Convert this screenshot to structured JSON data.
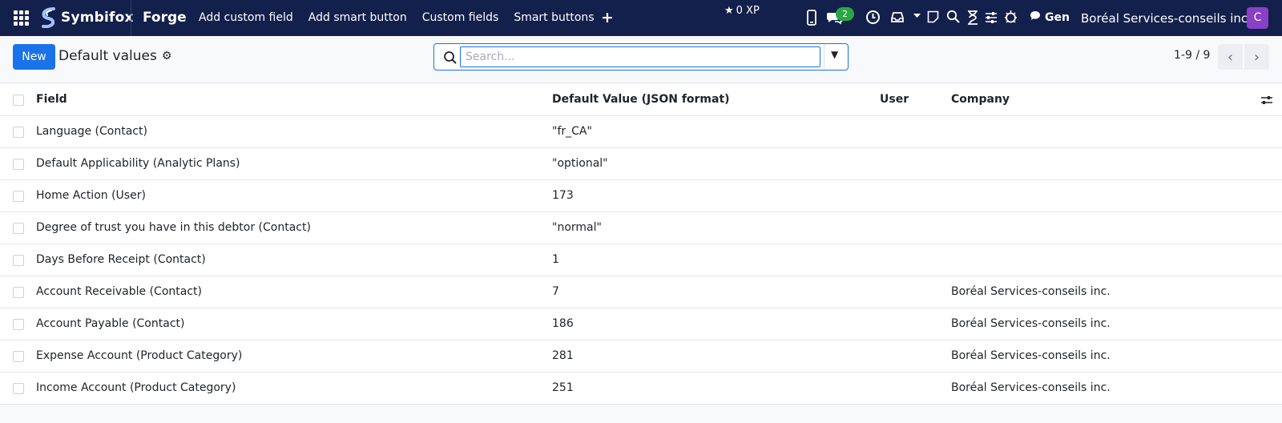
{
  "navbar": {
    "brand": "Symbifox",
    "app_name": "Forge",
    "menu": [
      "Add custom field",
      "Add smart button",
      "Custom fields",
      "Smart buttons"
    ],
    "xp": "0 XP",
    "messages_count": "2",
    "user_short": "Gen",
    "company": "Boréal Services-conseils inc.",
    "avatar_letter": "C"
  },
  "control": {
    "new_label": "New",
    "title": "Default values",
    "search_placeholder": "Search...",
    "pager": "1-9 / 9"
  },
  "table": {
    "headers": [
      "Field",
      "Default Value (JSON format)",
      "User",
      "Company"
    ],
    "rows": [
      {
        "field": "Language (Contact)",
        "value": "\"fr_CA\"",
        "user": "",
        "company": ""
      },
      {
        "field": "Default Applicability (Analytic Plans)",
        "value": "\"optional\"",
        "user": "",
        "company": ""
      },
      {
        "field": "Home Action (User)",
        "value": "173",
        "user": "",
        "company": ""
      },
      {
        "field": "Degree of trust you have in this debtor (Contact)",
        "value": "\"normal\"",
        "user": "",
        "company": ""
      },
      {
        "field": "Days Before Receipt (Contact)",
        "value": "1",
        "user": "",
        "company": ""
      },
      {
        "field": "Account Receivable (Contact)",
        "value": "7",
        "user": "",
        "company": "Boréal Services-conseils inc."
      },
      {
        "field": "Account Payable (Contact)",
        "value": "186",
        "user": "",
        "company": "Boréal Services-conseils inc."
      },
      {
        "field": "Expense Account (Product Category)",
        "value": "281",
        "user": "",
        "company": "Boréal Services-conseils inc."
      },
      {
        "field": "Income Account (Product Category)",
        "value": "251",
        "user": "",
        "company": "Boréal Services-conseils inc."
      }
    ]
  },
  "colors": {
    "navbar_bg": "#13204b",
    "primary": "#1a73e8",
    "badge": "#28a745",
    "avatar": "#8a3fc7"
  },
  "icons": [
    "apps-grid-icon",
    "plus-icon",
    "star-icon",
    "phone-icon",
    "chat-icon",
    "clock-icon",
    "inbox-icon",
    "note-icon",
    "search-icon",
    "hourglass-icon",
    "sliders-icon",
    "bug-icon",
    "gear-icon",
    "caret-down-icon",
    "chevron-left-icon",
    "chevron-right-icon",
    "column-options-icon"
  ]
}
